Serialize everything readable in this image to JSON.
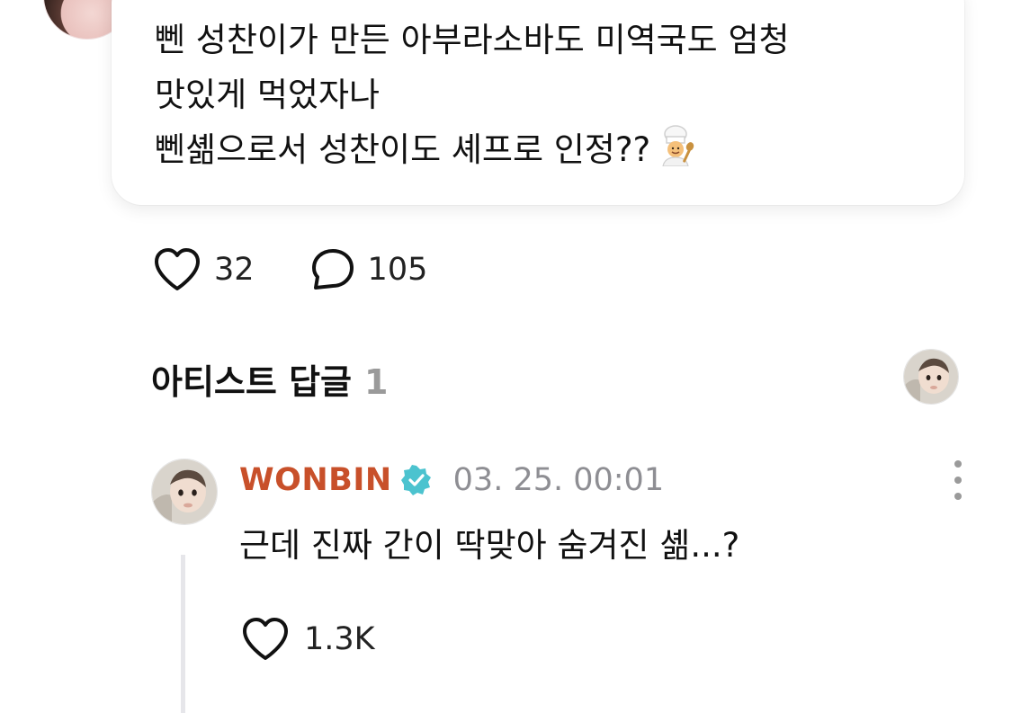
{
  "post": {
    "lines": [
      "뻰 성찬이가 만든 아부라소바도 미역국도 엄청",
      "맛있게 먹었자나",
      "뻰셺으로서 성찬이도 셰프로 인정??"
    ],
    "emoji_icon": "chef-emoji-icon"
  },
  "actions": {
    "like_count": "32",
    "comment_count": "105"
  },
  "artist_replies": {
    "title": "아티스트 답글",
    "count": "1"
  },
  "reply": {
    "author": "WONBIN",
    "timestamp": "03. 25. 00:01",
    "text": "근데 진짜 간이 딱맞아 숨겨진 셺...?",
    "like_count": "1.3K",
    "verified_color": "#4cc3cf",
    "author_color": "#c8502a"
  }
}
